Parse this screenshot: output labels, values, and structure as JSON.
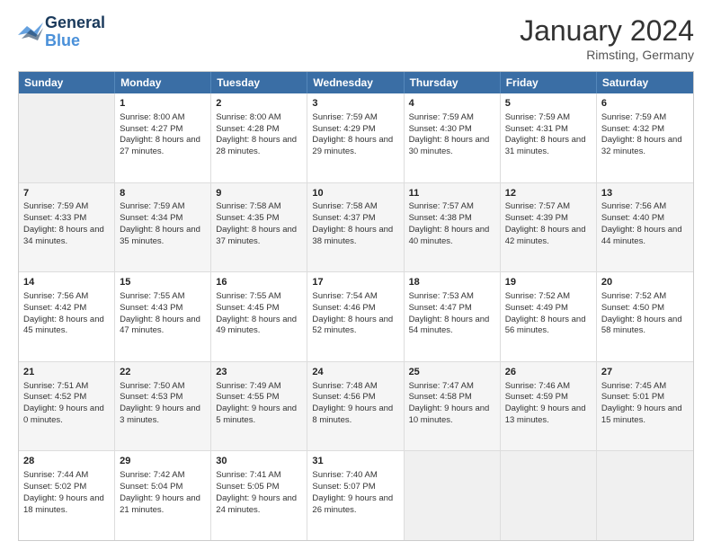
{
  "header": {
    "logo_line1": "General",
    "logo_line2": "Blue",
    "month_title": "January 2024",
    "location": "Rimsting, Germany"
  },
  "weekdays": [
    "Sunday",
    "Monday",
    "Tuesday",
    "Wednesday",
    "Thursday",
    "Friday",
    "Saturday"
  ],
  "rows": [
    [
      {
        "day": "",
        "empty": true
      },
      {
        "day": "1",
        "sunrise": "Sunrise: 8:00 AM",
        "sunset": "Sunset: 4:27 PM",
        "daylight": "Daylight: 8 hours and 27 minutes."
      },
      {
        "day": "2",
        "sunrise": "Sunrise: 8:00 AM",
        "sunset": "Sunset: 4:28 PM",
        "daylight": "Daylight: 8 hours and 28 minutes."
      },
      {
        "day": "3",
        "sunrise": "Sunrise: 7:59 AM",
        "sunset": "Sunset: 4:29 PM",
        "daylight": "Daylight: 8 hours and 29 minutes."
      },
      {
        "day": "4",
        "sunrise": "Sunrise: 7:59 AM",
        "sunset": "Sunset: 4:30 PM",
        "daylight": "Daylight: 8 hours and 30 minutes."
      },
      {
        "day": "5",
        "sunrise": "Sunrise: 7:59 AM",
        "sunset": "Sunset: 4:31 PM",
        "daylight": "Daylight: 8 hours and 31 minutes."
      },
      {
        "day": "6",
        "sunrise": "Sunrise: 7:59 AM",
        "sunset": "Sunset: 4:32 PM",
        "daylight": "Daylight: 8 hours and 32 minutes."
      }
    ],
    [
      {
        "day": "7",
        "sunrise": "Sunrise: 7:59 AM",
        "sunset": "Sunset: 4:33 PM",
        "daylight": "Daylight: 8 hours and 34 minutes."
      },
      {
        "day": "8",
        "sunrise": "Sunrise: 7:59 AM",
        "sunset": "Sunset: 4:34 PM",
        "daylight": "Daylight: 8 hours and 35 minutes."
      },
      {
        "day": "9",
        "sunrise": "Sunrise: 7:58 AM",
        "sunset": "Sunset: 4:35 PM",
        "daylight": "Daylight: 8 hours and 37 minutes."
      },
      {
        "day": "10",
        "sunrise": "Sunrise: 7:58 AM",
        "sunset": "Sunset: 4:37 PM",
        "daylight": "Daylight: 8 hours and 38 minutes."
      },
      {
        "day": "11",
        "sunrise": "Sunrise: 7:57 AM",
        "sunset": "Sunset: 4:38 PM",
        "daylight": "Daylight: 8 hours and 40 minutes."
      },
      {
        "day": "12",
        "sunrise": "Sunrise: 7:57 AM",
        "sunset": "Sunset: 4:39 PM",
        "daylight": "Daylight: 8 hours and 42 minutes."
      },
      {
        "day": "13",
        "sunrise": "Sunrise: 7:56 AM",
        "sunset": "Sunset: 4:40 PM",
        "daylight": "Daylight: 8 hours and 44 minutes."
      }
    ],
    [
      {
        "day": "14",
        "sunrise": "Sunrise: 7:56 AM",
        "sunset": "Sunset: 4:42 PM",
        "daylight": "Daylight: 8 hours and 45 minutes."
      },
      {
        "day": "15",
        "sunrise": "Sunrise: 7:55 AM",
        "sunset": "Sunset: 4:43 PM",
        "daylight": "Daylight: 8 hours and 47 minutes."
      },
      {
        "day": "16",
        "sunrise": "Sunrise: 7:55 AM",
        "sunset": "Sunset: 4:45 PM",
        "daylight": "Daylight: 8 hours and 49 minutes."
      },
      {
        "day": "17",
        "sunrise": "Sunrise: 7:54 AM",
        "sunset": "Sunset: 4:46 PM",
        "daylight": "Daylight: 8 hours and 52 minutes."
      },
      {
        "day": "18",
        "sunrise": "Sunrise: 7:53 AM",
        "sunset": "Sunset: 4:47 PM",
        "daylight": "Daylight: 8 hours and 54 minutes."
      },
      {
        "day": "19",
        "sunrise": "Sunrise: 7:52 AM",
        "sunset": "Sunset: 4:49 PM",
        "daylight": "Daylight: 8 hours and 56 minutes."
      },
      {
        "day": "20",
        "sunrise": "Sunrise: 7:52 AM",
        "sunset": "Sunset: 4:50 PM",
        "daylight": "Daylight: 8 hours and 58 minutes."
      }
    ],
    [
      {
        "day": "21",
        "sunrise": "Sunrise: 7:51 AM",
        "sunset": "Sunset: 4:52 PM",
        "daylight": "Daylight: 9 hours and 0 minutes."
      },
      {
        "day": "22",
        "sunrise": "Sunrise: 7:50 AM",
        "sunset": "Sunset: 4:53 PM",
        "daylight": "Daylight: 9 hours and 3 minutes."
      },
      {
        "day": "23",
        "sunrise": "Sunrise: 7:49 AM",
        "sunset": "Sunset: 4:55 PM",
        "daylight": "Daylight: 9 hours and 5 minutes."
      },
      {
        "day": "24",
        "sunrise": "Sunrise: 7:48 AM",
        "sunset": "Sunset: 4:56 PM",
        "daylight": "Daylight: 9 hours and 8 minutes."
      },
      {
        "day": "25",
        "sunrise": "Sunrise: 7:47 AM",
        "sunset": "Sunset: 4:58 PM",
        "daylight": "Daylight: 9 hours and 10 minutes."
      },
      {
        "day": "26",
        "sunrise": "Sunrise: 7:46 AM",
        "sunset": "Sunset: 4:59 PM",
        "daylight": "Daylight: 9 hours and 13 minutes."
      },
      {
        "day": "27",
        "sunrise": "Sunrise: 7:45 AM",
        "sunset": "Sunset: 5:01 PM",
        "daylight": "Daylight: 9 hours and 15 minutes."
      }
    ],
    [
      {
        "day": "28",
        "sunrise": "Sunrise: 7:44 AM",
        "sunset": "Sunset: 5:02 PM",
        "daylight": "Daylight: 9 hours and 18 minutes."
      },
      {
        "day": "29",
        "sunrise": "Sunrise: 7:42 AM",
        "sunset": "Sunset: 5:04 PM",
        "daylight": "Daylight: 9 hours and 21 minutes."
      },
      {
        "day": "30",
        "sunrise": "Sunrise: 7:41 AM",
        "sunset": "Sunset: 5:05 PM",
        "daylight": "Daylight: 9 hours and 24 minutes."
      },
      {
        "day": "31",
        "sunrise": "Sunrise: 7:40 AM",
        "sunset": "Sunset: 5:07 PM",
        "daylight": "Daylight: 9 hours and 26 minutes."
      },
      {
        "day": "",
        "empty": true
      },
      {
        "day": "",
        "empty": true
      },
      {
        "day": "",
        "empty": true
      }
    ]
  ]
}
